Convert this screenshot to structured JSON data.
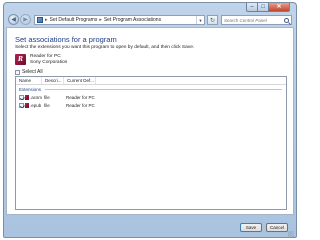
{
  "window": {
    "minimize_symbol": "–",
    "maximize_symbol": "□",
    "close_symbol": "✕"
  },
  "nav": {
    "back_symbol": "◀",
    "forward_symbol": "▶",
    "refresh_symbol": "↻"
  },
  "address": {
    "separator": "▸",
    "crumbs": [
      "Set Default Programs",
      "Set Program Associations"
    ]
  },
  "search": {
    "placeholder": "Search Control Panel"
  },
  "main": {
    "heading": "Set associations for a program",
    "instruction": "Select the extensions you want this program to open by default, and then click Save.",
    "program": {
      "icon_letter": "R",
      "name": "Reader for PC",
      "company": "Sony Corporation"
    },
    "select_all_label": "Select All",
    "select_all_checked": false
  },
  "list": {
    "columns": [
      "Name",
      "Descri...",
      "Current Def..."
    ],
    "group": "Extensions",
    "rows": [
      {
        "name": ".acsm",
        "description": "file",
        "current_default": "Reader for PC",
        "checked": true
      },
      {
        "name": ".epub",
        "description": "file",
        "current_default": "Reader for PC",
        "checked": true
      }
    ]
  },
  "footer": {
    "save_label": "Save",
    "cancel_label": "Cancel"
  },
  "colors": {
    "heading": "#1e3e8a",
    "titlebar": "#bfd3ea",
    "app_icon": "#b3224f"
  }
}
